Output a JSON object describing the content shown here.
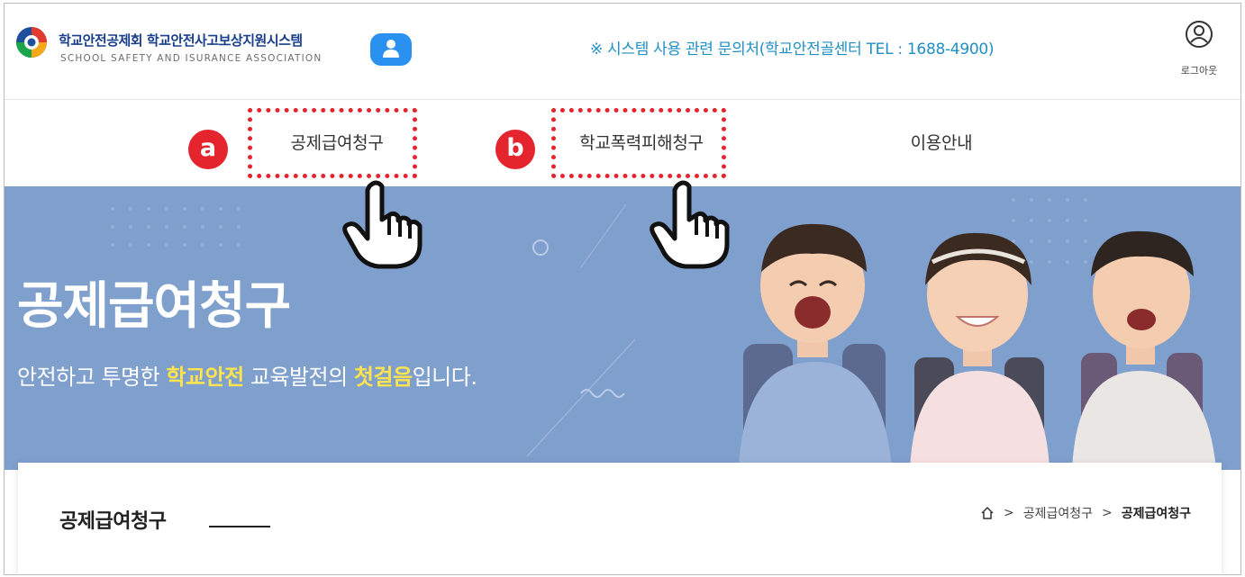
{
  "header": {
    "logo_title": "학교안전공제회 학교안전사고보상지원시스템",
    "logo_subtitle": "SCHOOL SAFETY AND ISURANCE ASSOCIATION",
    "notice": "※ 시스템 사용 관련 문의처(학교안전골센터 TEL : 1688-4900)",
    "logout_label": "로그아웃"
  },
  "nav": {
    "items": [
      {
        "label": "공제급여청구",
        "marker": "a"
      },
      {
        "label": "학교폭력피해청구",
        "marker": "b"
      },
      {
        "label": "이용안내"
      }
    ]
  },
  "hero": {
    "title": "공제급여청구",
    "subtitle_parts": [
      "안전하고 투명한 ",
      "학교안전",
      " 교육발전의 ",
      "첫걸음",
      "입니다."
    ]
  },
  "content": {
    "page_title": "공제급여청구",
    "breadcrumb": [
      "공제급여청구",
      "공제급여청구"
    ]
  },
  "colors": {
    "highlight_red": "#e4252e",
    "hero_bg": "#7f9fcc",
    "hero_accent": "#ffe44d",
    "notice_blue": "#1f8fc4",
    "logo_navy": "#1a3f8a"
  },
  "icons": [
    "school-safety-logo",
    "user-icon",
    "logout-icon",
    "pointer-hand-icon",
    "home-icon"
  ]
}
